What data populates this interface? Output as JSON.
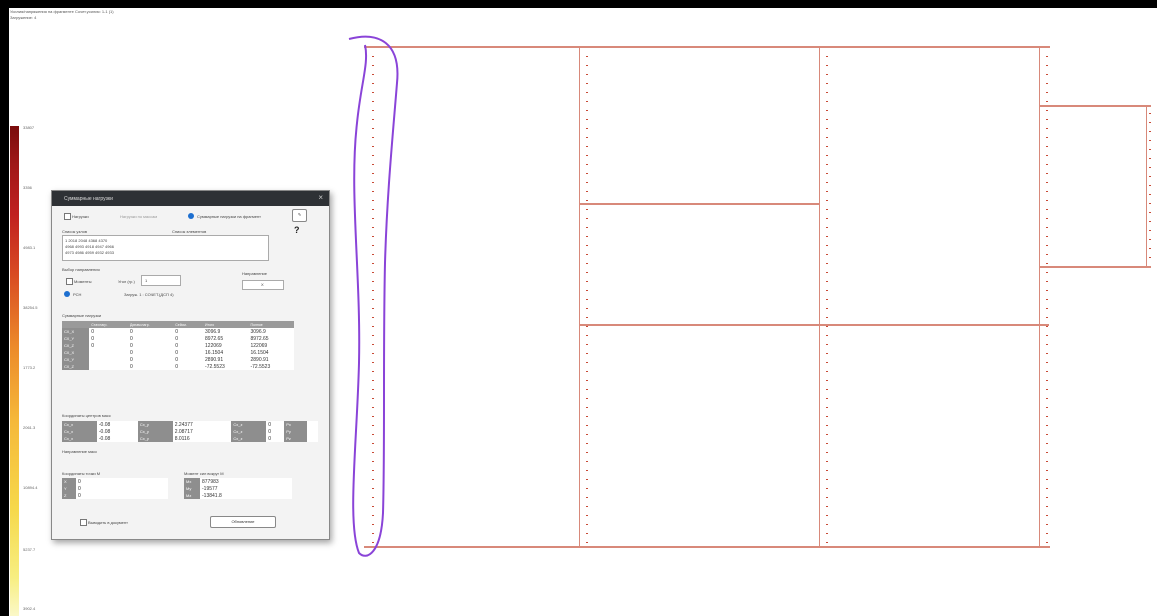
{
  "header": {
    "line1": "Усилия/напряжения на фрагменте  Сочет.усилия: 1-1 (1)",
    "line2": "Загружение: 4"
  },
  "legend": {
    "ticks": [
      "33807",
      "3356",
      "4983.1",
      "38254.5",
      "1773.2",
      "2061.3",
      "10894.4",
      "5237.7",
      "3902.4"
    ]
  },
  "dialog": {
    "title": "Суммарные нагрузки",
    "mode_grid": "Нагрузки",
    "mode_weights": "Нагрузки по массам",
    "mode_fragment": "Суммарные нагрузки на фрагмент",
    "help": "?",
    "nodes_label": "Список узлов",
    "elements_label": "Список элементов",
    "nodes_lines": [
      "1 2018 2048 4368 4370",
      "4968 4993 4918 4947 4966",
      "4973 4986 4959 4932 4933"
    ],
    "direction_label": "Выбор направления",
    "coord_label": "Направление",
    "coord_value": "X",
    "cb_moments": "Моменты",
    "angle_label": "Угол (гр.)",
    "angle_value": "1",
    "rsn_label": "РСН",
    "combo_label": "Загруж. 1 : СОЧЕТ.(ДСП 4)",
    "sum_label": "Суммарные нагрузки",
    "sum_cols": [
      "",
      "Стат.нагр.",
      "Динам.нагр.",
      "Сейсм.",
      "Итого",
      "Полное"
    ],
    "sum_rows": [
      [
        "СХ_X",
        "0",
        "0",
        "0",
        "3096.9",
        "3096.9"
      ],
      [
        "СХ_Y",
        "0",
        "0",
        "0",
        "8972.65",
        "8972.65"
      ],
      [
        "СХ_Z",
        "0",
        "0",
        "0",
        "122069",
        "122069"
      ],
      [
        "СХ_X",
        "",
        "0",
        "0",
        "16.1504",
        "16.1504"
      ],
      [
        "СХ_Y",
        "",
        "0",
        "0",
        "2890.91",
        "2890.91"
      ],
      [
        "СХ_Z",
        "",
        "0",
        "0",
        "-72.5523",
        "-72.5523"
      ]
    ],
    "centers_label": "Координаты центров масс",
    "centers_rows": [
      [
        "Сх_х",
        "-0.08",
        "Сх_у",
        "2.24377",
        "Сх_z",
        "0",
        "Рх",
        ""
      ],
      [
        "Сх_х",
        "-0.08",
        "Сх_у",
        "2.08717",
        "Сх_z",
        "0",
        "Ру",
        ""
      ],
      [
        "Сх_х",
        "-0.08",
        "Сх_у",
        "8.0116",
        "Сх_z",
        "0",
        "Рz",
        ""
      ]
    ],
    "crit_label": "Направление масс",
    "point_label": "Координаты точки М",
    "point_rows": [
      [
        "X",
        "0"
      ],
      [
        "Y",
        "0"
      ],
      [
        "Z",
        "0"
      ]
    ],
    "moment_label": "Момент сил вокруг М",
    "moment_rows": [
      [
        "Мx",
        "877983"
      ],
      [
        "Мy",
        "-19577"
      ],
      [
        "Мz",
        "-13841.8"
      ]
    ],
    "cb_bottom": "Выводить в документ",
    "apply_button": "Обновление"
  }
}
